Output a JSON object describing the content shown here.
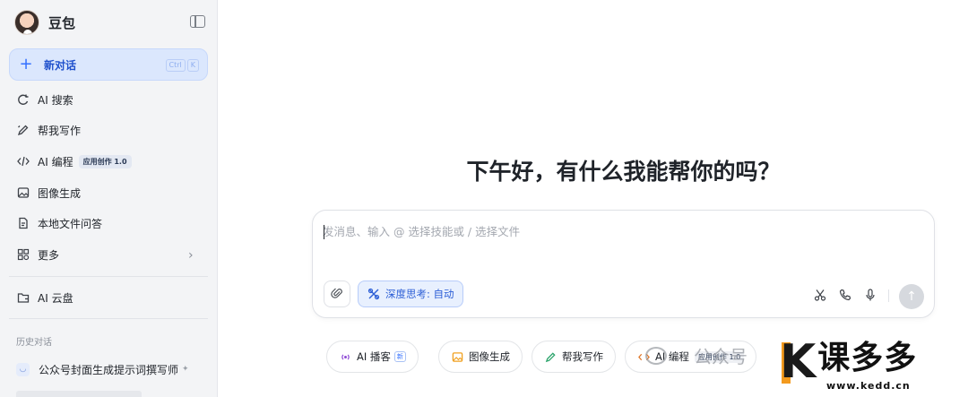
{
  "app": {
    "name": "豆包"
  },
  "sidebar": {
    "new_chat": {
      "label": "新对话",
      "shortcut": [
        "Ctrl",
        "K"
      ]
    },
    "items": [
      {
        "icon": "ai-search-icon",
        "label": "AI 搜索"
      },
      {
        "icon": "writing-pen-icon",
        "label": "帮我写作"
      },
      {
        "icon": "code-icon",
        "label": "AI 编程",
        "badge": "应用创作 1.0"
      },
      {
        "icon": "image-generate-icon",
        "label": "图像生成"
      },
      {
        "icon": "file-qa-icon",
        "label": "本地文件问答"
      },
      {
        "icon": "grid-more-icon",
        "label": "更多"
      },
      {
        "icon": "cloud-drive-icon",
        "label": "AI 云盘"
      }
    ],
    "history": {
      "title": "历史对话",
      "items": [
        {
          "label": "公众号封面生成提示词撰写师"
        }
      ]
    }
  },
  "main": {
    "greeting": "下午好，有什么我能帮你的吗？",
    "composer": {
      "placeholder": "发消息、输入 @ 选择技能或 / 选择文件",
      "deep_think_label": "深度思考: 自动"
    },
    "quick_actions": [
      {
        "icon": "podcast-icon",
        "label": "AI 播客",
        "badge": "新"
      },
      {
        "icon": "image-generate-icon",
        "label": "图像生成"
      },
      {
        "icon": "writing-pen-icon",
        "label": "帮我写作"
      },
      {
        "icon": "code-icon",
        "label": "AI 编程",
        "badge": "应用创作 1.0"
      }
    ]
  },
  "watermarks": {
    "wechat_text": "公众号",
    "logo_text": "课多多",
    "logo_url": "www.kedd.cn"
  },
  "colors": {
    "accent": "#3370ff",
    "new_chat_bg": "#dbe7fd",
    "sidebar_bg": "#f3f4f6",
    "logo_orange": "#f39a1e"
  }
}
